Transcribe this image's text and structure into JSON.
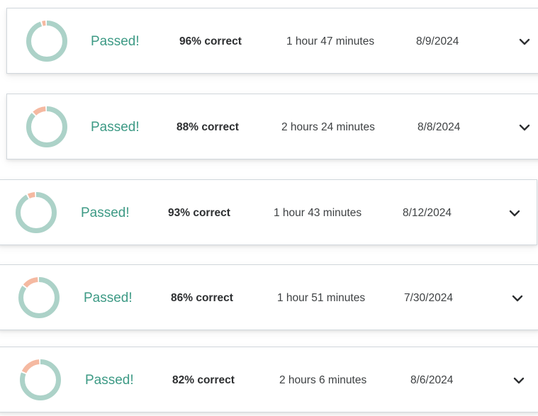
{
  "colors": {
    "ring_correct": "#acd2c8",
    "ring_incorrect": "#f5b9a1",
    "passed_text": "#3d9a85",
    "chevron": "#2d2f31"
  },
  "attempts": [
    {
      "status": "Passed!",
      "score_label": "96% correct",
      "score_fraction": 0.96,
      "duration": "1 hour 47 minutes",
      "date": "8/9/2024",
      "expand_icon": "chevron-down-icon"
    },
    {
      "status": "Passed!",
      "score_label": "88% correct",
      "score_fraction": 0.88,
      "duration": "2 hours 24 minutes",
      "date": "8/8/2024",
      "expand_icon": "chevron-down-icon"
    },
    {
      "status": "Passed!",
      "score_label": "93% correct",
      "score_fraction": 0.93,
      "duration": "1 hour 43 minutes",
      "date": "8/12/2024",
      "expand_icon": "chevron-down-icon"
    },
    {
      "status": "Passed!",
      "score_label": "86% correct",
      "score_fraction": 0.86,
      "duration": "1 hour 51 minutes",
      "date": "7/30/2024",
      "expand_icon": "chevron-down-icon"
    },
    {
      "status": "Passed!",
      "score_label": "82% correct",
      "score_fraction": 0.82,
      "duration": "2 hours 6 minutes",
      "date": "8/6/2024",
      "expand_icon": "chevron-down-icon"
    }
  ]
}
